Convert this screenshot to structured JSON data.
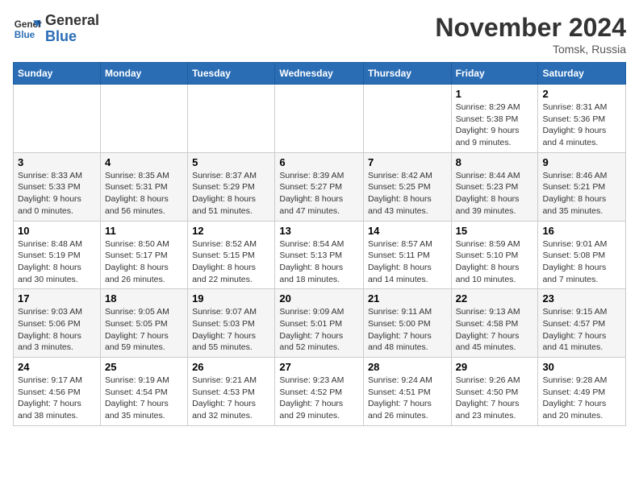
{
  "header": {
    "logo_general": "General",
    "logo_blue": "Blue",
    "month": "November 2024",
    "location": "Tomsk, Russia"
  },
  "columns": [
    "Sunday",
    "Monday",
    "Tuesday",
    "Wednesday",
    "Thursday",
    "Friday",
    "Saturday"
  ],
  "weeks": [
    [
      {
        "day": "",
        "detail": ""
      },
      {
        "day": "",
        "detail": ""
      },
      {
        "day": "",
        "detail": ""
      },
      {
        "day": "",
        "detail": ""
      },
      {
        "day": "",
        "detail": ""
      },
      {
        "day": "1",
        "detail": "Sunrise: 8:29 AM\nSunset: 5:38 PM\nDaylight: 9 hours\nand 9 minutes."
      },
      {
        "day": "2",
        "detail": "Sunrise: 8:31 AM\nSunset: 5:36 PM\nDaylight: 9 hours\nand 4 minutes."
      }
    ],
    [
      {
        "day": "3",
        "detail": "Sunrise: 8:33 AM\nSunset: 5:33 PM\nDaylight: 9 hours\nand 0 minutes."
      },
      {
        "day": "4",
        "detail": "Sunrise: 8:35 AM\nSunset: 5:31 PM\nDaylight: 8 hours\nand 56 minutes."
      },
      {
        "day": "5",
        "detail": "Sunrise: 8:37 AM\nSunset: 5:29 PM\nDaylight: 8 hours\nand 51 minutes."
      },
      {
        "day": "6",
        "detail": "Sunrise: 8:39 AM\nSunset: 5:27 PM\nDaylight: 8 hours\nand 47 minutes."
      },
      {
        "day": "7",
        "detail": "Sunrise: 8:42 AM\nSunset: 5:25 PM\nDaylight: 8 hours\nand 43 minutes."
      },
      {
        "day": "8",
        "detail": "Sunrise: 8:44 AM\nSunset: 5:23 PM\nDaylight: 8 hours\nand 39 minutes."
      },
      {
        "day": "9",
        "detail": "Sunrise: 8:46 AM\nSunset: 5:21 PM\nDaylight: 8 hours\nand 35 minutes."
      }
    ],
    [
      {
        "day": "10",
        "detail": "Sunrise: 8:48 AM\nSunset: 5:19 PM\nDaylight: 8 hours\nand 30 minutes."
      },
      {
        "day": "11",
        "detail": "Sunrise: 8:50 AM\nSunset: 5:17 PM\nDaylight: 8 hours\nand 26 minutes."
      },
      {
        "day": "12",
        "detail": "Sunrise: 8:52 AM\nSunset: 5:15 PM\nDaylight: 8 hours\nand 22 minutes."
      },
      {
        "day": "13",
        "detail": "Sunrise: 8:54 AM\nSunset: 5:13 PM\nDaylight: 8 hours\nand 18 minutes."
      },
      {
        "day": "14",
        "detail": "Sunrise: 8:57 AM\nSunset: 5:11 PM\nDaylight: 8 hours\nand 14 minutes."
      },
      {
        "day": "15",
        "detail": "Sunrise: 8:59 AM\nSunset: 5:10 PM\nDaylight: 8 hours\nand 10 minutes."
      },
      {
        "day": "16",
        "detail": "Sunrise: 9:01 AM\nSunset: 5:08 PM\nDaylight: 8 hours\nand 7 minutes."
      }
    ],
    [
      {
        "day": "17",
        "detail": "Sunrise: 9:03 AM\nSunset: 5:06 PM\nDaylight: 8 hours\nand 3 minutes."
      },
      {
        "day": "18",
        "detail": "Sunrise: 9:05 AM\nSunset: 5:05 PM\nDaylight: 7 hours\nand 59 minutes."
      },
      {
        "day": "19",
        "detail": "Sunrise: 9:07 AM\nSunset: 5:03 PM\nDaylight: 7 hours\nand 55 minutes."
      },
      {
        "day": "20",
        "detail": "Sunrise: 9:09 AM\nSunset: 5:01 PM\nDaylight: 7 hours\nand 52 minutes."
      },
      {
        "day": "21",
        "detail": "Sunrise: 9:11 AM\nSunset: 5:00 PM\nDaylight: 7 hours\nand 48 minutes."
      },
      {
        "day": "22",
        "detail": "Sunrise: 9:13 AM\nSunset: 4:58 PM\nDaylight: 7 hours\nand 45 minutes."
      },
      {
        "day": "23",
        "detail": "Sunrise: 9:15 AM\nSunset: 4:57 PM\nDaylight: 7 hours\nand 41 minutes."
      }
    ],
    [
      {
        "day": "24",
        "detail": "Sunrise: 9:17 AM\nSunset: 4:56 PM\nDaylight: 7 hours\nand 38 minutes."
      },
      {
        "day": "25",
        "detail": "Sunrise: 9:19 AM\nSunset: 4:54 PM\nDaylight: 7 hours\nand 35 minutes."
      },
      {
        "day": "26",
        "detail": "Sunrise: 9:21 AM\nSunset: 4:53 PM\nDaylight: 7 hours\nand 32 minutes."
      },
      {
        "day": "27",
        "detail": "Sunrise: 9:23 AM\nSunset: 4:52 PM\nDaylight: 7 hours\nand 29 minutes."
      },
      {
        "day": "28",
        "detail": "Sunrise: 9:24 AM\nSunset: 4:51 PM\nDaylight: 7 hours\nand 26 minutes."
      },
      {
        "day": "29",
        "detail": "Sunrise: 9:26 AM\nSunset: 4:50 PM\nDaylight: 7 hours\nand 23 minutes."
      },
      {
        "day": "30",
        "detail": "Sunrise: 9:28 AM\nSunset: 4:49 PM\nDaylight: 7 hours\nand 20 minutes."
      }
    ]
  ]
}
